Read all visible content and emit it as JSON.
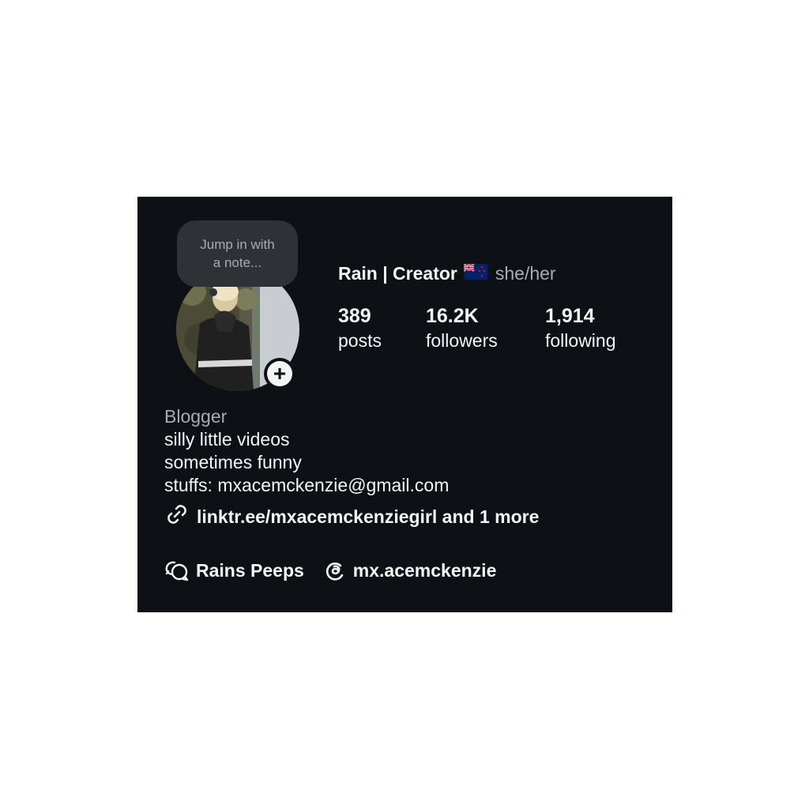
{
  "note": {
    "line1": "Jump in with",
    "line2": "a note..."
  },
  "profile": {
    "name": "Rain | Creator",
    "flag_icon": "new-zealand-flag-icon",
    "pronouns": "she/her",
    "add_icon": "plus-icon"
  },
  "stats": [
    {
      "value": "389",
      "label": "posts"
    },
    {
      "value": "16.2K",
      "label": "followers"
    },
    {
      "value": "1,914",
      "label": "following"
    }
  ],
  "bio": {
    "category": "Blogger",
    "lines": [
      "silly little videos",
      "sometimes funny",
      "stuffs: mxacemckenzie@gmail.com"
    ]
  },
  "link": {
    "icon": "link-icon",
    "text": "linktr.ee/mxacemckenziegirl and 1 more"
  },
  "social": {
    "channel": {
      "icon": "broadcast-channel-icon",
      "label": "Rains Peeps"
    },
    "threads": {
      "icon": "threads-icon",
      "label": "mx.acemckenzie"
    }
  },
  "colors": {
    "background": "#0d1014",
    "text": "#f5f5f5",
    "muted": "#a8acb1",
    "bubble": "#2e3236"
  }
}
